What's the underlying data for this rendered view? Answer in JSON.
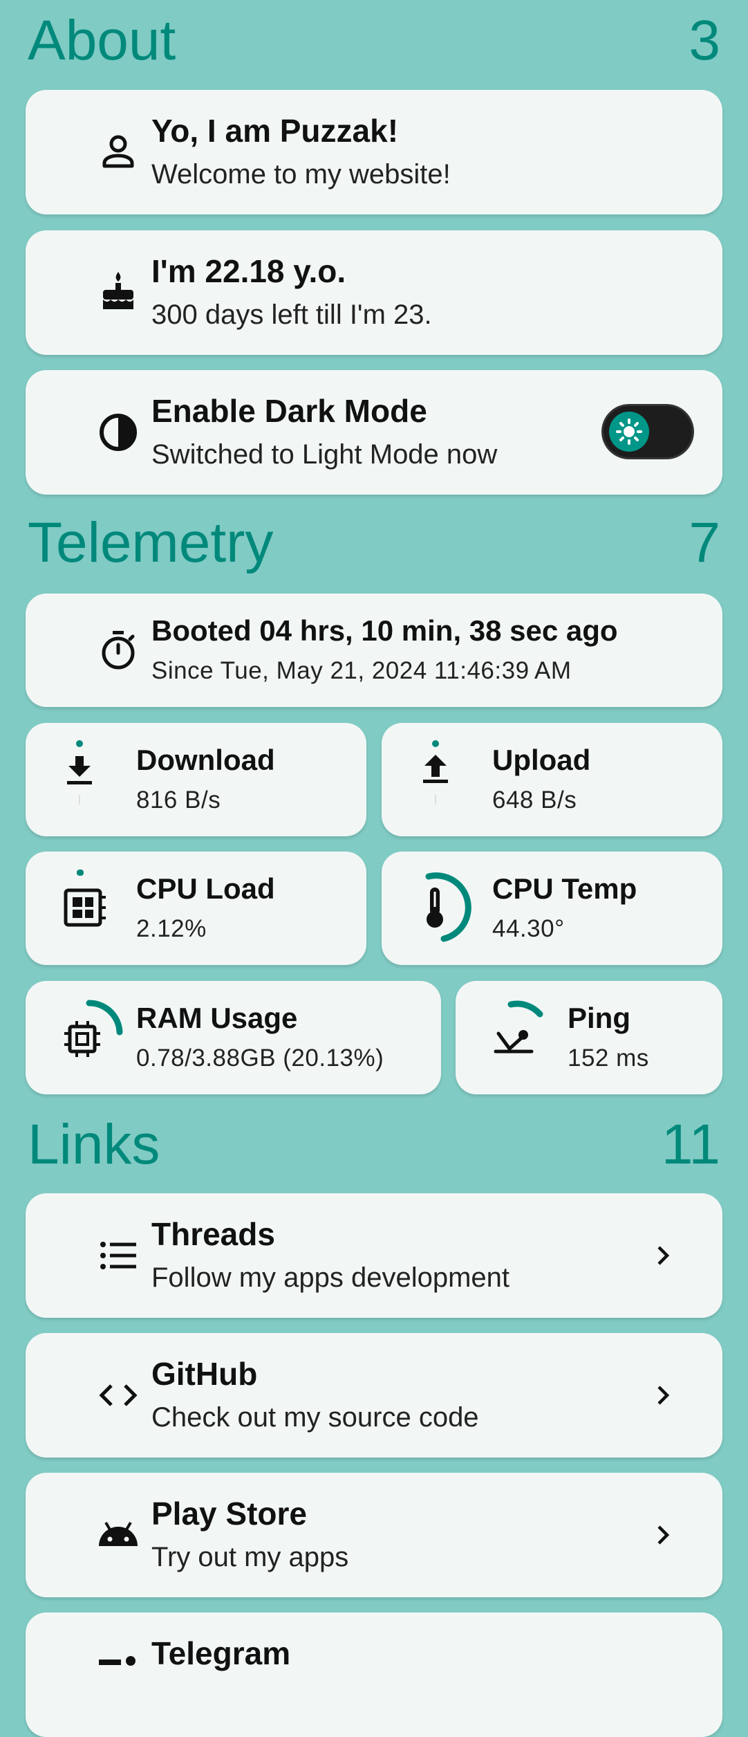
{
  "about": {
    "title": "About",
    "count": "3",
    "items": [
      {
        "title": "Yo, I am Puzzak!",
        "subtitle": "Welcome to my website!",
        "icon": "person-icon"
      },
      {
        "title": "I'm 22.18 y.o.",
        "subtitle": "300 days left till I'm 23.",
        "icon": "cake-icon"
      },
      {
        "title": "Enable Dark Mode",
        "subtitle": "Switched to Light Mode now",
        "icon": "contrast-icon"
      }
    ],
    "dark_mode_on": false
  },
  "telemetry": {
    "title": "Telemetry",
    "count": "7",
    "boot": {
      "title": "Booted 04 hrs, 10 min, 38 sec ago",
      "subtitle": "Since Tue, May 21, 2024 11:46:39 AM"
    },
    "download": {
      "title": "Download",
      "value": "816 B/s"
    },
    "upload": {
      "title": "Upload",
      "value": "648 B/s"
    },
    "cpu_load": {
      "title": "CPU Load",
      "value": "2.12%"
    },
    "cpu_temp": {
      "title": "CPU Temp",
      "value": "44.30°"
    },
    "ram": {
      "title": "RAM Usage",
      "value": "0.78/3.88GB (20.13%)"
    },
    "ping": {
      "title": "Ping",
      "value": "152 ms"
    }
  },
  "links": {
    "title": "Links",
    "count": "11",
    "items": [
      {
        "title": "Threads",
        "subtitle": "Follow my apps development",
        "icon": "list-icon"
      },
      {
        "title": "GitHub",
        "subtitle": "Check out my source code",
        "icon": "code-icon"
      },
      {
        "title": "Play Store",
        "subtitle": "Try out my apps",
        "icon": "android-icon"
      },
      {
        "title": "Telegram",
        "subtitle": "",
        "icon": "telegram-icon"
      }
    ]
  },
  "colors": {
    "accent": "#00897b",
    "background": "#80cbc4",
    "card": "#f2f7f6"
  }
}
